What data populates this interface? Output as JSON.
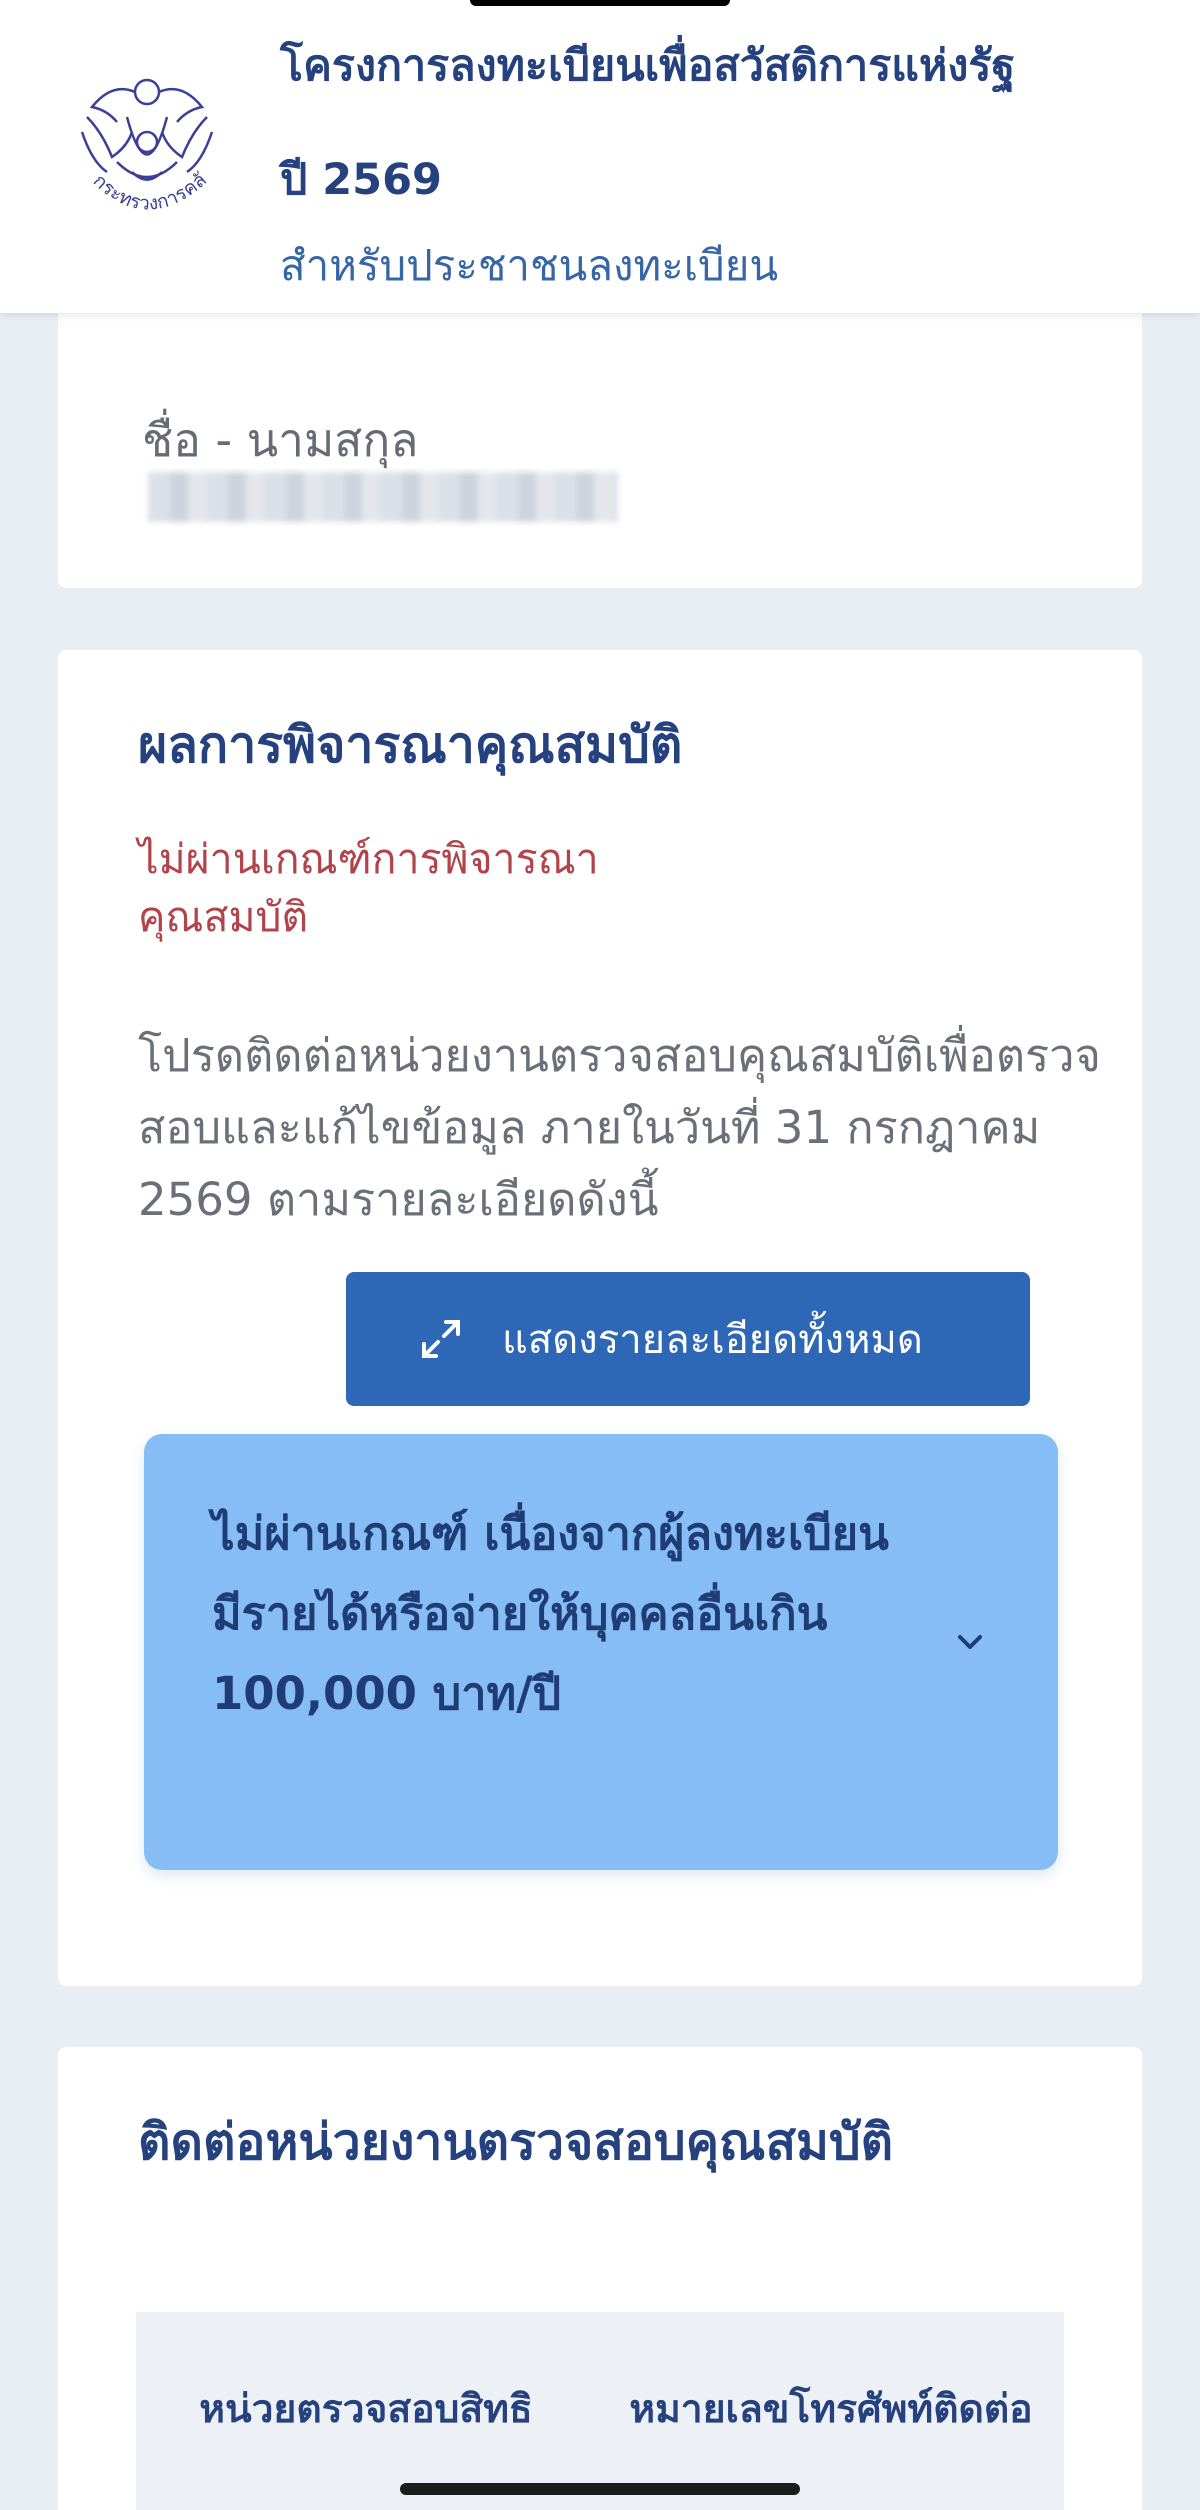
{
  "header": {
    "title": "โครงการลงทะเบียนเพื่อสวัสดิการแห่งรัฐ",
    "year": "ปี 2569",
    "subtitle": "สำหรับประชาชนลงทะเบียน",
    "logo_text": "กระทรวงการคลัง",
    "logo_icon": "garuda-emblem"
  },
  "profile": {
    "name_label": "ชื่อ - นามสกุล",
    "name_value": ""
  },
  "result": {
    "title": "ผลการพิจารณาคุณสมบัติ",
    "status": "ไม่ผ่านเกณฑ์การพิจารณาคุณสมบัติ",
    "instruction": "โปรดติดต่อหน่วยงานตรวจสอบคุณสมบัติเพื่อตรวจสอบและแก้ไขข้อมูล ภายในวันที่ 31 กรกฎาคม 2569 ตามรายละเอียดดังนี้",
    "show_all_label": "แสดงรายละเอียดทั้งหมด",
    "reason": "ไม่ผ่านเกณฑ์ เนื่องจากผู้ลงทะเบียนมีรายได้หรือจ่ายให้บุคคลอื่นเกิน 100,000 บาท/ปี"
  },
  "contact": {
    "title": "ติดต่อหน่วยงานตรวจสอบคุณสมบัติ",
    "columns": [
      "หน่วยตรวจสอบสิทธิ",
      "หมายเลขโทรศัพท์ติดต่อ"
    ]
  },
  "colors": {
    "primary": "#2e67b5",
    "heading": "#25427e",
    "status_fail": "#b0444a",
    "accordion_bg": "#86bdf5"
  }
}
